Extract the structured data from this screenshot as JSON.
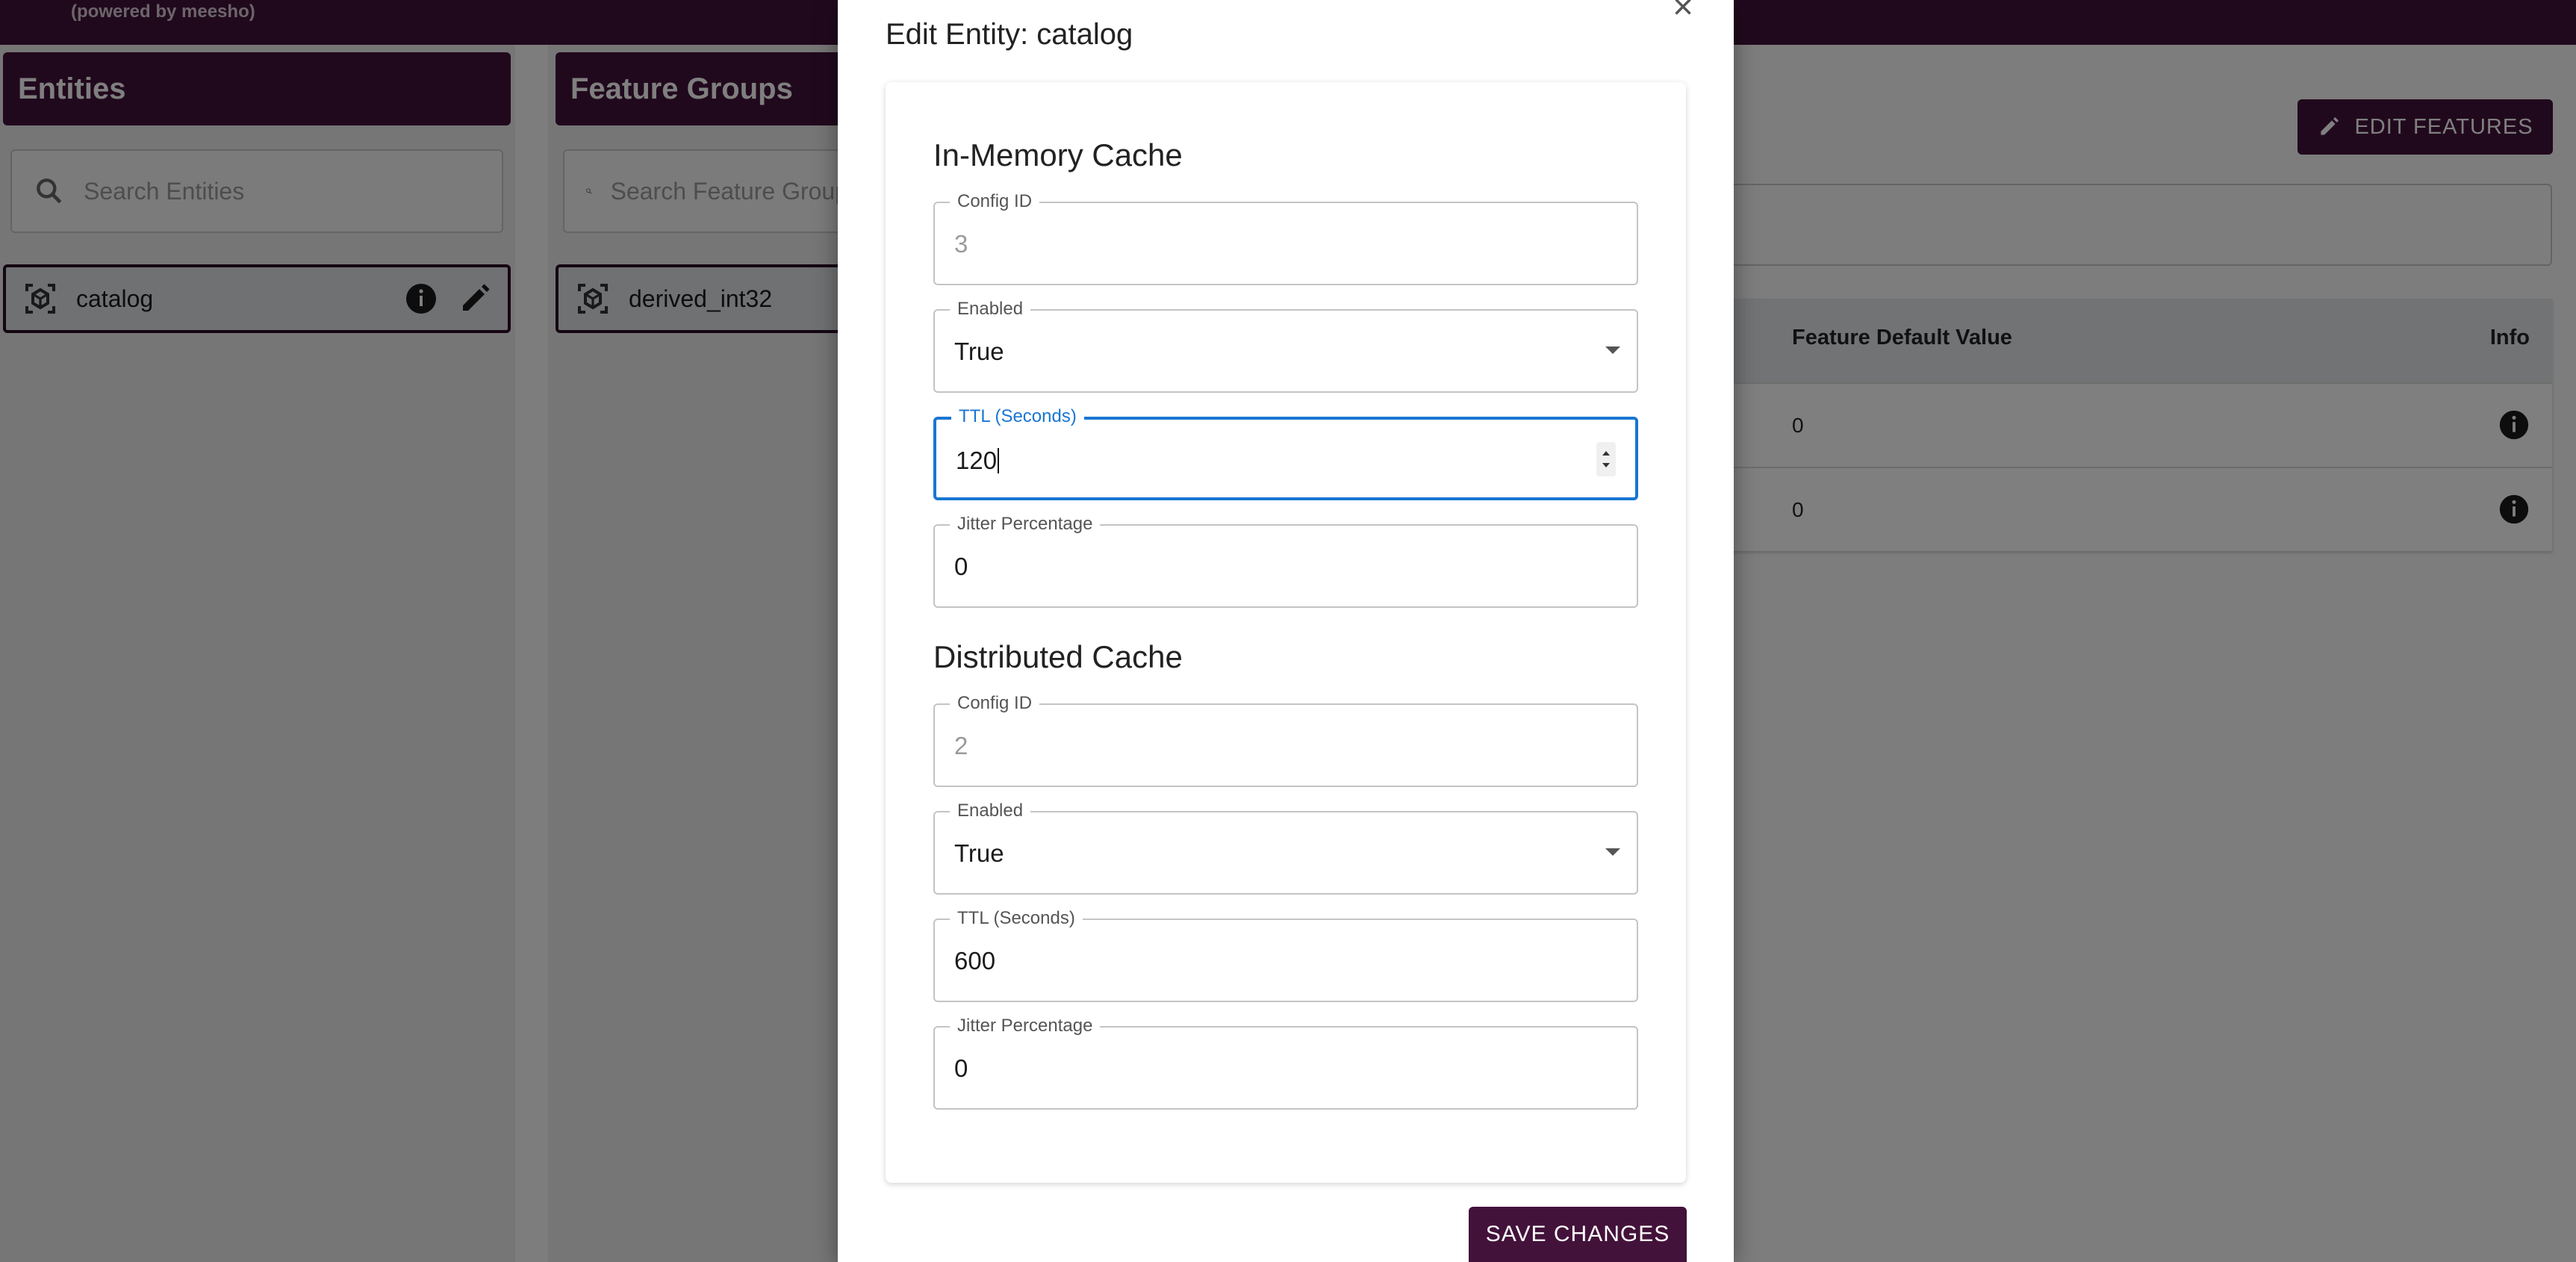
{
  "app": {
    "powered_by": "(powered by meesho)"
  },
  "entities_panel": {
    "title": "Entities",
    "search_placeholder": "Search Entities",
    "items": [
      {
        "label": "catalog"
      }
    ]
  },
  "feature_groups_panel": {
    "title": "Feature Groups",
    "search_placeholder": "Search Feature Groups",
    "items": [
      {
        "label": "derived_int32"
      }
    ]
  },
  "features_panel": {
    "edit_button": "EDIT FEATURES",
    "columns": [
      "Feature Default Value",
      "Info"
    ],
    "rows": [
      {
        "default_value": "0"
      },
      {
        "default_value": "0"
      }
    ]
  },
  "dialog": {
    "title": "Edit Entity: catalog",
    "close_glyph": "×",
    "in_memory": {
      "heading": "In-Memory Cache",
      "config_id": {
        "label": "Config ID",
        "value": "3"
      },
      "enabled": {
        "label": "Enabled",
        "value": "True"
      },
      "ttl": {
        "label": "TTL (Seconds)",
        "value": "120"
      },
      "jitter": {
        "label": "Jitter Percentage",
        "value": "0"
      }
    },
    "distributed": {
      "heading": "Distributed Cache",
      "config_id": {
        "label": "Config ID",
        "value": "2"
      },
      "enabled": {
        "label": "Enabled",
        "value": "True"
      },
      "ttl": {
        "label": "TTL (Seconds)",
        "value": "600"
      },
      "jitter": {
        "label": "Jitter Percentage",
        "value": "0"
      }
    },
    "save_button": "SAVE CHANGES"
  },
  "colors": {
    "brand": "#43123a",
    "focus": "#1976d2"
  },
  "icons": [
    "search-icon",
    "entity-icon",
    "info-icon",
    "pencil-icon",
    "close-icon",
    "chevron-down-icon",
    "spinner-icon"
  ]
}
